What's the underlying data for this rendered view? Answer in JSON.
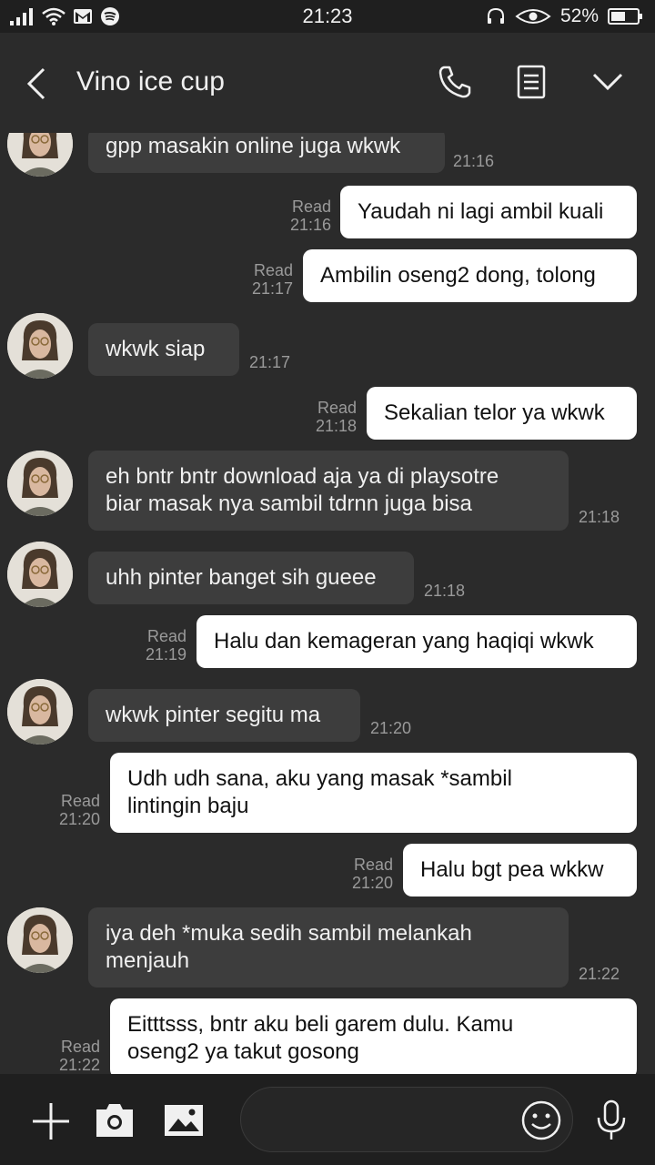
{
  "status": {
    "time": "21:23",
    "battery": "52%"
  },
  "header": {
    "title": "Vino ice cup"
  },
  "messages": [
    {
      "dir": "in",
      "lines": [
        "gpp masakin online juga wkwk"
      ],
      "time": "21:16"
    },
    {
      "dir": "out",
      "lines": [
        "Yaudah ni lagi ambil kuali"
      ],
      "read": "Read",
      "time": "21:16"
    },
    {
      "dir": "out",
      "lines": [
        "Ambilin oseng2 dong, tolong"
      ],
      "read": "Read",
      "time": "21:17"
    },
    {
      "dir": "in",
      "lines": [
        "wkwk siap"
      ],
      "time": "21:17"
    },
    {
      "dir": "out",
      "lines": [
        "Sekalian telor ya wkwk"
      ],
      "read": "Read",
      "time": "21:18"
    },
    {
      "dir": "in",
      "lines": [
        "eh bntr bntr download aja ya di playsotre",
        "biar masak nya sambil tdrnn juga bisa"
      ],
      "time": "21:18"
    },
    {
      "dir": "in",
      "lines": [
        "uhh pinter banget sih gueee"
      ],
      "time": "21:18"
    },
    {
      "dir": "out",
      "lines": [
        "Halu dan kemageran yang haqiqi wkwk"
      ],
      "read": "Read",
      "time": "21:19"
    },
    {
      "dir": "in",
      "lines": [
        "wkwk pinter segitu ma"
      ],
      "time": "21:20"
    },
    {
      "dir": "out",
      "lines": [
        "Udh udh sana, aku yang masak *sambil",
        "lintingin baju"
      ],
      "read": "Read",
      "time": "21:20"
    },
    {
      "dir": "out",
      "lines": [
        "Halu bgt pea wkkw"
      ],
      "read": "Read",
      "time": "21:20"
    },
    {
      "dir": "in",
      "lines": [
        "iya deh *muka sedih sambil melankah",
        "menjauh"
      ],
      "time": "21:22"
    },
    {
      "dir": "out",
      "lines": [
        "Eitttsss, bntr aku beli garem dulu. Kamu",
        "oseng2 ya takut gosong"
      ],
      "read": "Read",
      "time": "21:22"
    }
  ],
  "input": {
    "placeholder": ""
  },
  "colors": {
    "background": "#2b2b2b",
    "incoming_bubble": "#3d3d3d",
    "outgoing_bubble": "#ffffff",
    "bars": "#1f1f1f"
  },
  "icons": [
    "back-arrow-icon",
    "phone-icon",
    "notes-icon",
    "chevron-down-icon",
    "plus-icon",
    "camera-icon",
    "image-icon",
    "emoji-icon",
    "microphone-icon"
  ]
}
